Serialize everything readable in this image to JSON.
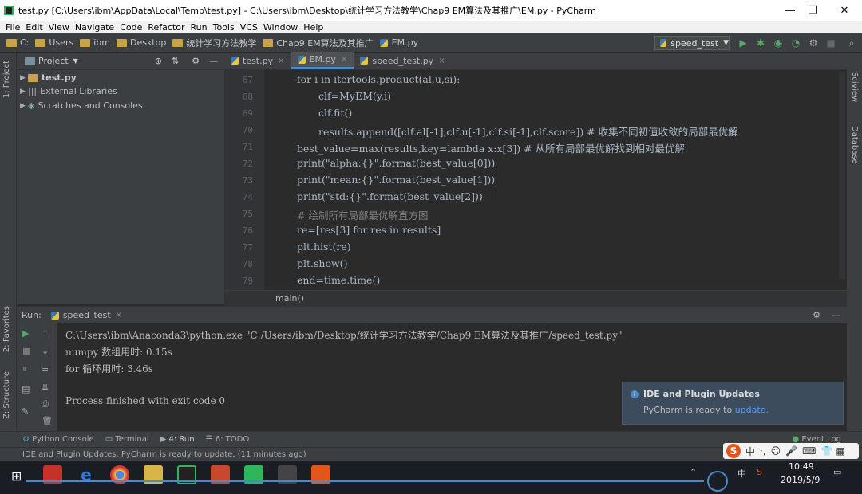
{
  "window": {
    "title": "test.py [C:\\Users\\ibm\\AppData\\Local\\Temp\\test.py] - C:\\Users\\ibm\\Desktop\\统计学习方法教学\\Chap9 EM算法及其推广\\EM.py - PyCharm",
    "minimize": "—",
    "maximize": "❐",
    "close": "✕"
  },
  "menu": [
    "File",
    "Edit",
    "View",
    "Navigate",
    "Code",
    "Refactor",
    "Run",
    "Tools",
    "VCS",
    "Window",
    "Help"
  ],
  "navbar": {
    "crumbs": [
      "C:",
      "Users",
      "ibm",
      "Desktop",
      "统计学习方法教学",
      "Chap9 EM算法及其推广",
      "EM.py"
    ],
    "run_config": "speed_test"
  },
  "project": {
    "header": "Project",
    "items": [
      "test.py",
      "External Libraries",
      "Scratches and Consoles"
    ]
  },
  "left_tabs": {
    "project": "1: Project",
    "favorites": "2: Favorites",
    "structure": "Z: Structure"
  },
  "right_tabs": {
    "sciview": "SciView",
    "database": "Database"
  },
  "editor_tabs": [
    {
      "label": "test.py",
      "active": false
    },
    {
      "label": "EM.py",
      "active": true
    },
    {
      "label": "speed_test.py",
      "active": false
    }
  ],
  "code": {
    "line_numbers": [
      "67",
      "68",
      "69",
      "70",
      "71",
      "72",
      "73",
      "74",
      "75",
      "76",
      "77",
      "78",
      "79"
    ],
    "lines": [
      "for i in itertools.product(al,u,si):",
      "clf=MyEM(y,i)",
      "clf.fit()",
      "results.append([clf.al[-1],clf.u[-1],clf.si[-1],clf.score]) # 收集不同初值收敛的局部最优解",
      "best_value=max(results,key=lambda x:x[3]) # 从所有局部最优解找到相对最优解",
      "print(\"alpha:{}\".format(best_value[0]))",
      "print(\"mean:{}\".format(best_value[1]))",
      "print(\"std:{}\".format(best_value[2]))",
      "# 绘制所有局部最优解直方图",
      "re=[res[3] for res in results]",
      "plt.hist(re)",
      "plt.show()",
      "end=time.time()"
    ],
    "breadcrumb": "main()"
  },
  "run": {
    "label": "Run:",
    "tab": "speed_test",
    "output": [
      "C:\\Users\\ibm\\Anaconda3\\python.exe \"C:/Users/ibm/Desktop/统计学习方法教学/Chap9 EM算法及其推广/speed_test.py\"",
      "numpy 数组用时: 0.15s",
      "for 循环用时: 3.46s",
      "",
      "Process finished with exit code 0"
    ]
  },
  "notification": {
    "title": "IDE and Plugin Updates",
    "body": "PyCharm is ready to ",
    "link": "update."
  },
  "tool_windows": [
    "Python Console",
    "Terminal",
    "4: Run",
    "6: TODO"
  ],
  "event_log": "Event Log",
  "status": "IDE and Plugin Updates: PyCharm is ready to update. (11 minutes ago)",
  "ime": {
    "lang": "中",
    "mode": "·,"
  },
  "taskbar": {
    "time": "10:49",
    "date": "2019/5/9",
    "lang": "中"
  },
  "colors": {
    "keyword": "#cc7832",
    "string": "#6a8759",
    "comment": "#808080",
    "accent": "#4a88c7"
  }
}
